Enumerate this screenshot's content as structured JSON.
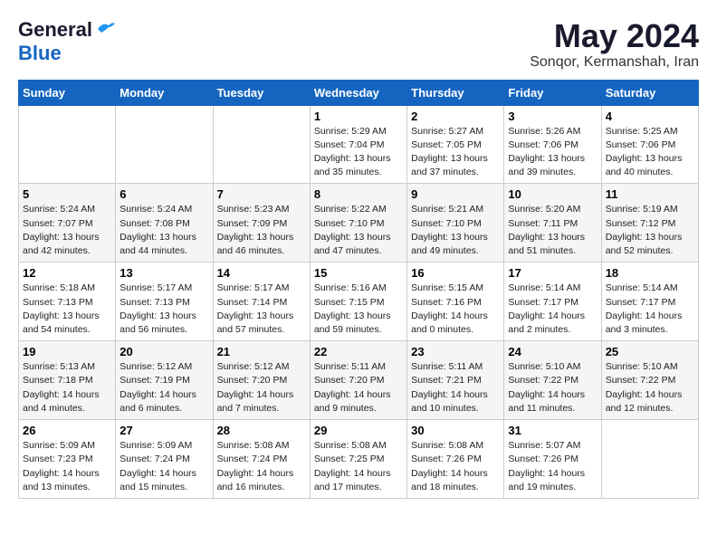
{
  "logo": {
    "line1": "General",
    "line2": "Blue"
  },
  "title": "May 2024",
  "subtitle": "Sonqor, Kermanshah, Iran",
  "weekdays": [
    "Sunday",
    "Monday",
    "Tuesday",
    "Wednesday",
    "Thursday",
    "Friday",
    "Saturday"
  ],
  "weeks": [
    [
      {
        "day": "",
        "info": ""
      },
      {
        "day": "",
        "info": ""
      },
      {
        "day": "",
        "info": ""
      },
      {
        "day": "1",
        "info": "Sunrise: 5:29 AM\nSunset: 7:04 PM\nDaylight: 13 hours\nand 35 minutes."
      },
      {
        "day": "2",
        "info": "Sunrise: 5:27 AM\nSunset: 7:05 PM\nDaylight: 13 hours\nand 37 minutes."
      },
      {
        "day": "3",
        "info": "Sunrise: 5:26 AM\nSunset: 7:06 PM\nDaylight: 13 hours\nand 39 minutes."
      },
      {
        "day": "4",
        "info": "Sunrise: 5:25 AM\nSunset: 7:06 PM\nDaylight: 13 hours\nand 40 minutes."
      }
    ],
    [
      {
        "day": "5",
        "info": "Sunrise: 5:24 AM\nSunset: 7:07 PM\nDaylight: 13 hours\nand 42 minutes."
      },
      {
        "day": "6",
        "info": "Sunrise: 5:24 AM\nSunset: 7:08 PM\nDaylight: 13 hours\nand 44 minutes."
      },
      {
        "day": "7",
        "info": "Sunrise: 5:23 AM\nSunset: 7:09 PM\nDaylight: 13 hours\nand 46 minutes."
      },
      {
        "day": "8",
        "info": "Sunrise: 5:22 AM\nSunset: 7:10 PM\nDaylight: 13 hours\nand 47 minutes."
      },
      {
        "day": "9",
        "info": "Sunrise: 5:21 AM\nSunset: 7:10 PM\nDaylight: 13 hours\nand 49 minutes."
      },
      {
        "day": "10",
        "info": "Sunrise: 5:20 AM\nSunset: 7:11 PM\nDaylight: 13 hours\nand 51 minutes."
      },
      {
        "day": "11",
        "info": "Sunrise: 5:19 AM\nSunset: 7:12 PM\nDaylight: 13 hours\nand 52 minutes."
      }
    ],
    [
      {
        "day": "12",
        "info": "Sunrise: 5:18 AM\nSunset: 7:13 PM\nDaylight: 13 hours\nand 54 minutes."
      },
      {
        "day": "13",
        "info": "Sunrise: 5:17 AM\nSunset: 7:13 PM\nDaylight: 13 hours\nand 56 minutes."
      },
      {
        "day": "14",
        "info": "Sunrise: 5:17 AM\nSunset: 7:14 PM\nDaylight: 13 hours\nand 57 minutes."
      },
      {
        "day": "15",
        "info": "Sunrise: 5:16 AM\nSunset: 7:15 PM\nDaylight: 13 hours\nand 59 minutes."
      },
      {
        "day": "16",
        "info": "Sunrise: 5:15 AM\nSunset: 7:16 PM\nDaylight: 14 hours\nand 0 minutes."
      },
      {
        "day": "17",
        "info": "Sunrise: 5:14 AM\nSunset: 7:17 PM\nDaylight: 14 hours\nand 2 minutes."
      },
      {
        "day": "18",
        "info": "Sunrise: 5:14 AM\nSunset: 7:17 PM\nDaylight: 14 hours\nand 3 minutes."
      }
    ],
    [
      {
        "day": "19",
        "info": "Sunrise: 5:13 AM\nSunset: 7:18 PM\nDaylight: 14 hours\nand 4 minutes."
      },
      {
        "day": "20",
        "info": "Sunrise: 5:12 AM\nSunset: 7:19 PM\nDaylight: 14 hours\nand 6 minutes."
      },
      {
        "day": "21",
        "info": "Sunrise: 5:12 AM\nSunset: 7:20 PM\nDaylight: 14 hours\nand 7 minutes."
      },
      {
        "day": "22",
        "info": "Sunrise: 5:11 AM\nSunset: 7:20 PM\nDaylight: 14 hours\nand 9 minutes."
      },
      {
        "day": "23",
        "info": "Sunrise: 5:11 AM\nSunset: 7:21 PM\nDaylight: 14 hours\nand 10 minutes."
      },
      {
        "day": "24",
        "info": "Sunrise: 5:10 AM\nSunset: 7:22 PM\nDaylight: 14 hours\nand 11 minutes."
      },
      {
        "day": "25",
        "info": "Sunrise: 5:10 AM\nSunset: 7:22 PM\nDaylight: 14 hours\nand 12 minutes."
      }
    ],
    [
      {
        "day": "26",
        "info": "Sunrise: 5:09 AM\nSunset: 7:23 PM\nDaylight: 14 hours\nand 13 minutes."
      },
      {
        "day": "27",
        "info": "Sunrise: 5:09 AM\nSunset: 7:24 PM\nDaylight: 14 hours\nand 15 minutes."
      },
      {
        "day": "28",
        "info": "Sunrise: 5:08 AM\nSunset: 7:24 PM\nDaylight: 14 hours\nand 16 minutes."
      },
      {
        "day": "29",
        "info": "Sunrise: 5:08 AM\nSunset: 7:25 PM\nDaylight: 14 hours\nand 17 minutes."
      },
      {
        "day": "30",
        "info": "Sunrise: 5:08 AM\nSunset: 7:26 PM\nDaylight: 14 hours\nand 18 minutes."
      },
      {
        "day": "31",
        "info": "Sunrise: 5:07 AM\nSunset: 7:26 PM\nDaylight: 14 hours\nand 19 minutes."
      },
      {
        "day": "",
        "info": ""
      }
    ]
  ]
}
